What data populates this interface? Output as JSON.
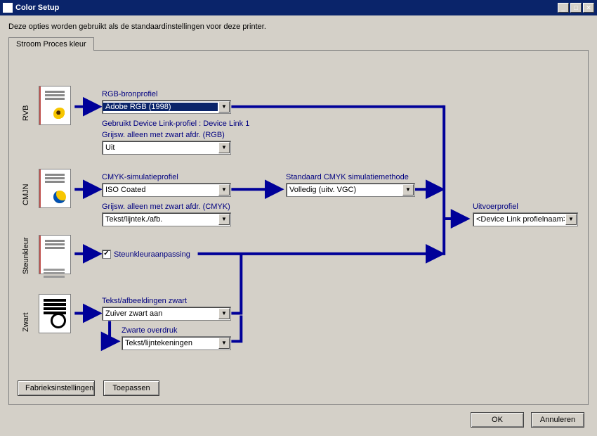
{
  "window": {
    "title": "Color Setup"
  },
  "intro": "Deze opties worden gebruikt als de standaardinstellingen voor deze printer.",
  "tab": {
    "label": "Stroom Proces kleur"
  },
  "sections": {
    "rvb": "RVB",
    "cmjn": "CMJN",
    "steun": "Steunkleur",
    "zwart": "Zwart"
  },
  "labels": {
    "rgb_source": "RGB-bronprofiel",
    "device_link_used": "Gebruikt Device Link-profiel : Device Link 1",
    "gray_rgb": "Grijsw. alleen met zwart afdr. (RGB)",
    "cmyk_sim": "CMYK-simulatieprofiel",
    "cmyk_method": "Standaard CMYK simulatiemethode",
    "gray_cmyk": "Grijsw. alleen met zwart afdr. (CMYK)",
    "output_profile": "Uitvoerprofiel",
    "spot_match": "Steunkleuraanpassing",
    "text_graphics_black": "Tekst/afbeeldingen zwart",
    "black_overprint": "Zwarte overdruk"
  },
  "values": {
    "rgb_source": "Adobe RGB (1998)",
    "gray_rgb": "Uit",
    "cmyk_sim": "ISO Coated",
    "cmyk_method": "Volledig (uitv. VGC)",
    "gray_cmyk": "Tekst/lijntek./afb.",
    "output_profile": "<Device Link profielnaam>",
    "text_graphics_black": "Zuiver zwart aan",
    "black_overprint": "Tekst/lijntekeningen"
  },
  "buttons": {
    "factory": "Fabrieksinstellingen",
    "apply": "Toepassen",
    "ok": "OK",
    "cancel": "Annuleren"
  },
  "colors": {
    "flow": "#000099"
  }
}
